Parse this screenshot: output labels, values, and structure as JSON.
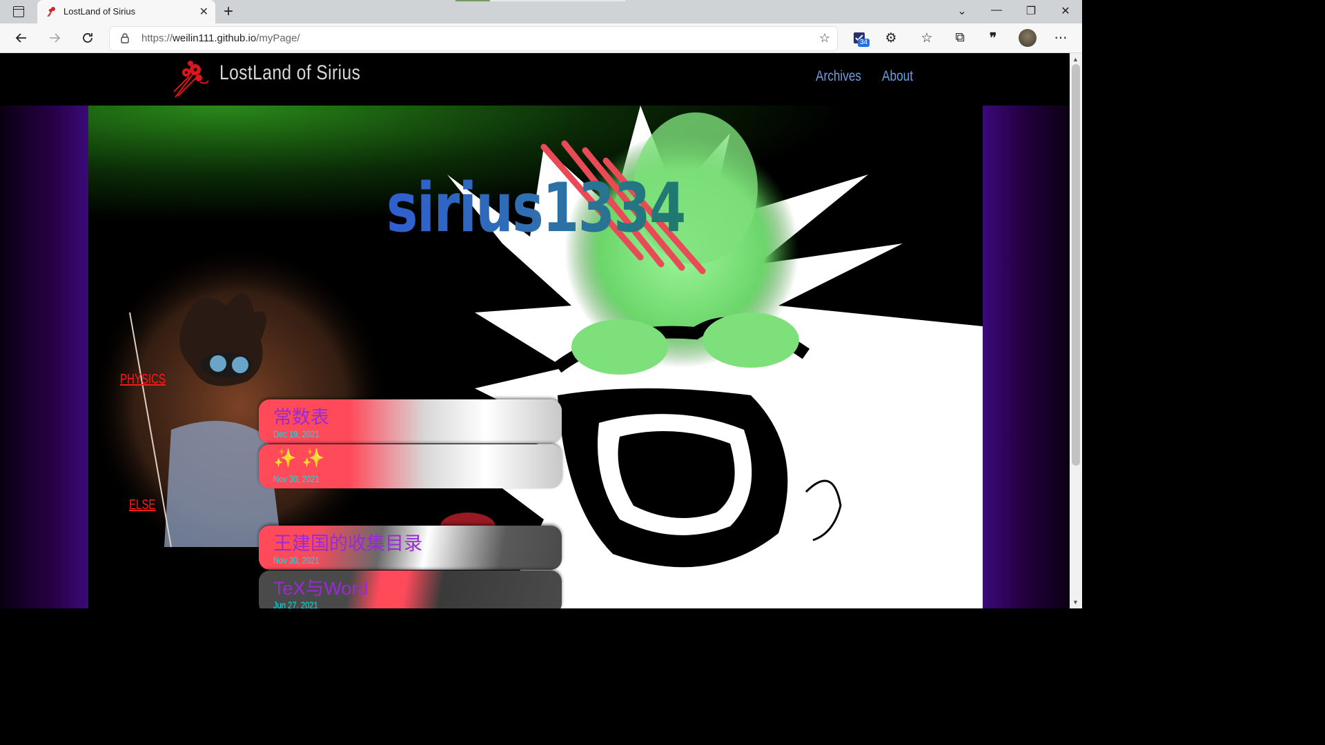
{
  "browser": {
    "tab_title": "LostLand of Sirius",
    "tab_close": "✕",
    "new_tab": "+",
    "url_prefix": "https://",
    "url_host": "weilin111.github.io",
    "url_path": "/myPage/",
    "badge_count": "34",
    "window_controls": [
      "⌄",
      "—",
      "❐",
      "✕"
    ],
    "icons": [
      "back-icon",
      "forward-icon",
      "refresh-icon",
      "lock-icon",
      "add-favorite-icon",
      "extension-icon",
      "puzzle-icon",
      "favorites-icon",
      "collections-icon",
      "quote-icon",
      "profile-avatar",
      "more-icon"
    ]
  },
  "site": {
    "title": "LostLand of Sirius",
    "nav": [
      "Archives",
      "About"
    ],
    "hero_text": "sirius1334"
  },
  "categories": [
    {
      "name": "PHYSICS",
      "posts": [
        {
          "title": "常数表",
          "date": "Dec 19, 2021"
        },
        {
          "title": "✨ ✨",
          "date": "Nov 30, 2021"
        }
      ]
    },
    {
      "name": "ELSE",
      "posts": [
        {
          "title": "王建国的收集目录",
          "date": "Nov 30, 2021"
        },
        {
          "title": "TeX与Word",
          "date": "Jun 27, 2021"
        }
      ]
    }
  ],
  "colors": {
    "nav_link": "#6e9de0",
    "category": "#ff1a1a",
    "post_title": "#9a2ad6",
    "post_date": "#00e6e6",
    "side_purple": "#3b0a7a"
  }
}
